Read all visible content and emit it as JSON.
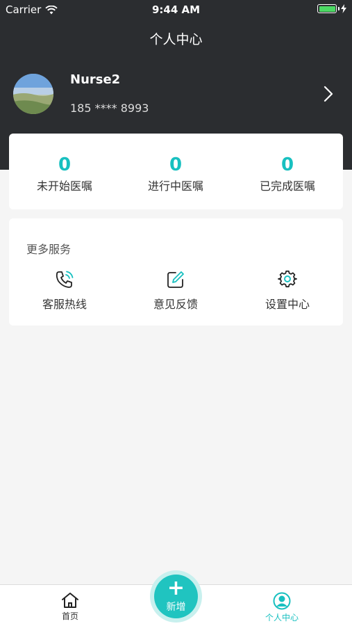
{
  "status_bar": {
    "carrier": "Carrier",
    "time": "9:44 AM"
  },
  "nav": {
    "title": "个人中心"
  },
  "profile": {
    "name": "Nurse2",
    "phone": "185 **** 8993"
  },
  "orders": [
    {
      "count": "0",
      "label": "未开始医嘱"
    },
    {
      "count": "0",
      "label": "进行中医嘱"
    },
    {
      "count": "0",
      "label": "已完成医嘱"
    }
  ],
  "services": {
    "title": "更多服务",
    "items": [
      {
        "label": "客服热线",
        "icon": "phone-icon"
      },
      {
        "label": "意见反馈",
        "icon": "edit-icon"
      },
      {
        "label": "设置中心",
        "icon": "gear-icon"
      }
    ]
  },
  "tabbar": {
    "home_label": "首页",
    "add_label": "新增",
    "add_symbol": "+",
    "me_label": "个人中心"
  },
  "colors": {
    "header_bg": "#2b2d30",
    "accent": "#18c0c0",
    "battery": "#4cd964"
  }
}
